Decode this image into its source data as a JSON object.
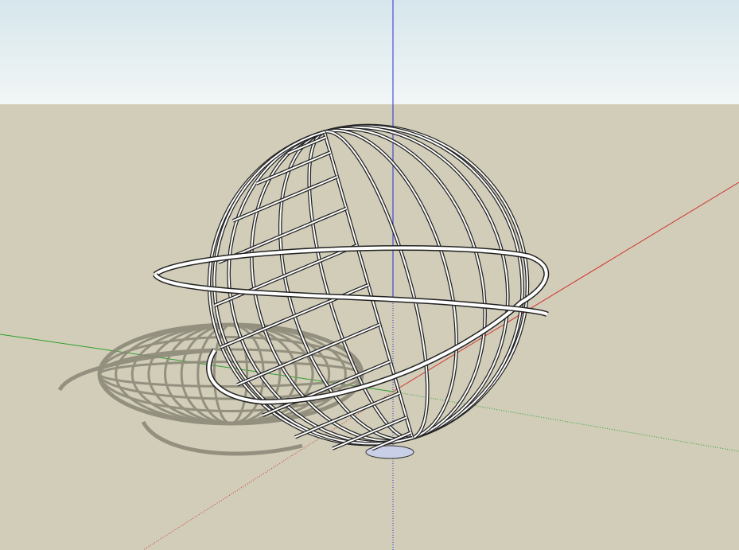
{
  "viewport": {
    "sky_color_top": "#d6e6ec",
    "sky_color_bottom": "#f2f6f6",
    "ground_color": "#d1cdb8"
  },
  "axes": {
    "blue_axis_color": "#2b2bd6",
    "red_axis_color": "#d23232",
    "green_axis_color": "#2fa02f"
  },
  "model": {
    "object": "wireframe-globe-with-ring",
    "frame_color": "#ffffff",
    "outline_color": "#222222",
    "shadow_color": "#8a8676",
    "base_color": "#c9cfe6"
  }
}
